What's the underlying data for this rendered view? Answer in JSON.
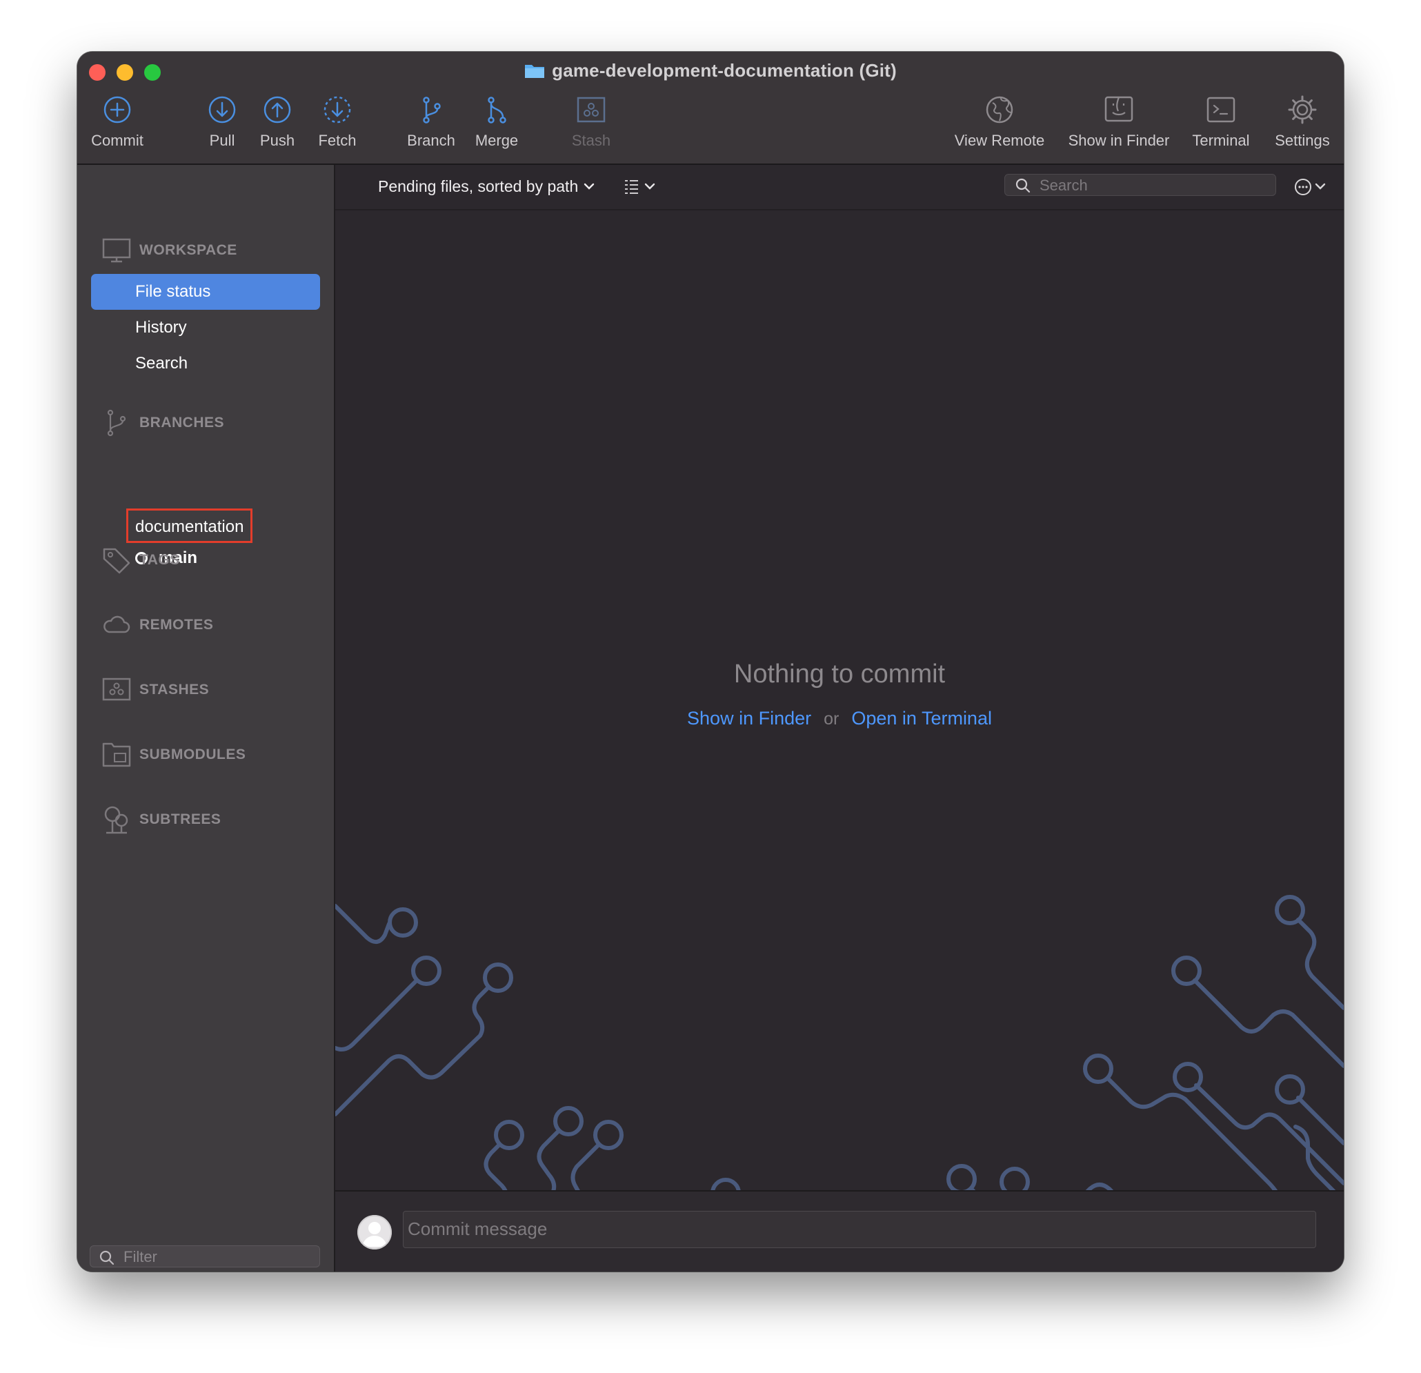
{
  "window": {
    "title": "game-development-documentation (Git)"
  },
  "toolbar": {
    "commit": "Commit",
    "pull": "Pull",
    "push": "Push",
    "fetch": "Fetch",
    "branch": "Branch",
    "merge": "Merge",
    "stash": "Stash",
    "view_remote": "View Remote",
    "show_in_finder": "Show in Finder",
    "terminal": "Terminal",
    "settings": "Settings"
  },
  "sidebar": {
    "workspace": {
      "heading": "WORKSPACE",
      "items": [
        "File status",
        "History",
        "Search"
      ],
      "active": "File status"
    },
    "branches": {
      "heading": "BRANCHES",
      "items": [
        "documentation",
        "main"
      ],
      "current": "main"
    },
    "tags": "TAGS",
    "remotes": "REMOTES",
    "stashes": "STASHES",
    "submodules": "SUBMODULES",
    "subtrees": "SUBTREES",
    "filter_placeholder": "Filter"
  },
  "main": {
    "sort_label": "Pending files, sorted by path",
    "search_placeholder": "Search",
    "empty_title": "Nothing to commit",
    "show_in_finder": "Show in Finder",
    "or": "or",
    "open_in_terminal": "Open in Terminal",
    "commit_placeholder": "Commit message"
  },
  "colors": {
    "accent": "#4f86e0",
    "link": "#4e98ff",
    "highlight_box": "#e33d2b",
    "icon_blue": "#4a8fe0"
  },
  "icons": {
    "commit": "plus-circle-icon",
    "pull": "arrow-down-circle-icon",
    "push": "arrow-up-circle-icon",
    "fetch": "dashed-arrow-down-circle-icon",
    "branch": "branch-icon",
    "merge": "merge-icon",
    "stash": "stash-icon",
    "view_remote": "globe-icon",
    "show_in_finder": "finder-icon",
    "terminal": "terminal-icon",
    "settings": "gear-icon"
  }
}
